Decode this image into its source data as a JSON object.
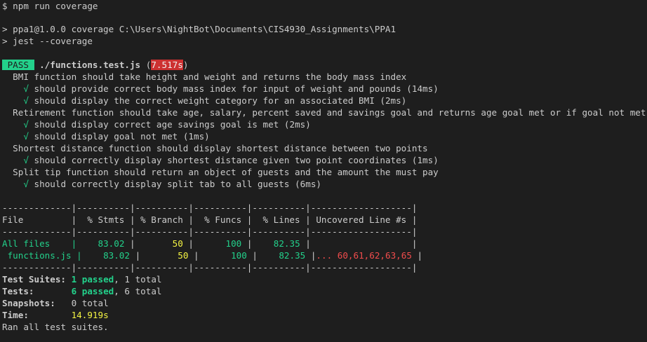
{
  "terminal": {
    "prompt": "$ npm run coverage",
    "script_line": "> ppa1@1.0.0 coverage C:\\Users\\NightBot\\Documents\\CIS4930_Assignments\\PPA1",
    "jest_line": "> jest --coverage",
    "pass_label": " PASS ",
    "test_file": " ./functions.test.js",
    "duration_open": " (",
    "duration": "7.517s",
    "duration_close": ")",
    "check_mark": "√",
    "suites": [
      {
        "title": "BMI function should take height and weight and returns the body mass index",
        "tests": [
          {
            "name": "should provide correct body mass index for input of weight and pounds",
            "time": "(14ms)"
          },
          {
            "name": "should display the correct weight category for an associated BMI",
            "time": "(2ms)"
          }
        ]
      },
      {
        "title": "Retirement function should take age, salary, percent saved and savings goal and returns age goal met or if goal not met",
        "tests": [
          {
            "name": "should display correct age savings goal is met",
            "time": "(2ms)"
          },
          {
            "name": "should display goal not met",
            "time": "(1ms)"
          }
        ]
      },
      {
        "title": "Shortest distance function should display shortest distance between two points",
        "tests": [
          {
            "name": "should correctly display shortest distance given two point coordinates",
            "time": "(1ms)"
          }
        ]
      },
      {
        "title": "Split tip function should return an object of guests and the amount the must pay",
        "tests": [
          {
            "name": "should correctly display split tab to all guests",
            "time": "(6ms)"
          }
        ]
      }
    ],
    "coverage_table": {
      "separator": "-------------|----------|----------|----------|----------|-------------------|",
      "header": "File         |  % Stmts | % Branch |  % Funcs |  % Lines | Uncovered Line #s |",
      "row_all": {
        "pad": "All files    |    ",
        "stmts": "83.02",
        "sep1": " |       ",
        "branch": "50",
        "sep2": " |      ",
        "funcs": "100",
        "sep3": " |    ",
        "lines": "82.35",
        "sep4": " |                   |"
      },
      "row_fn": {
        "pad": " functions.js |    ",
        "stmts": "83.02",
        "sep1": " |       ",
        "branch": "50",
        "sep2": " |      ",
        "funcs": "100",
        "sep3": " |    ",
        "lines": "82.35",
        "sep4": " |",
        "uncovered": "... 60,61,62,63,65",
        "end": " |"
      }
    },
    "summary": {
      "suites_label": "Test Suites: ",
      "suites_passed": "1 passed",
      "suites_total": ", 1 total",
      "tests_label": "Tests:       ",
      "tests_passed": "6 passed",
      "tests_total": ", 6 total",
      "snapshots_label": "Snapshots:   ",
      "snapshots_value": "0 total",
      "time_label": "Time:        ",
      "time_value": "14.919s",
      "ran": "Ran all test suites."
    }
  }
}
